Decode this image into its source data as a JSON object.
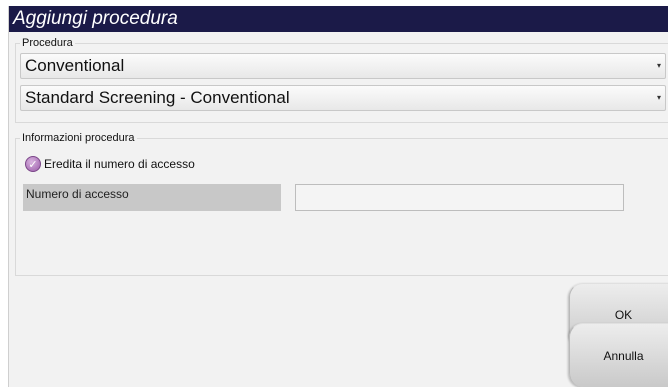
{
  "dialog": {
    "title": "Aggiungi procedura"
  },
  "procedure_section": {
    "legend": "Procedura",
    "procedure_select": {
      "value": "Conventional",
      "caret_icon": "chevron-down-icon"
    },
    "protocol_select": {
      "value": "Standard Screening - Conventional",
      "caret_icon": "chevron-down-icon"
    }
  },
  "info_section": {
    "legend": "Informazioni procedura",
    "inherit_checkbox": {
      "label": "Eredita il numero di accesso",
      "checked": true,
      "icon": "check-icon",
      "color": "#9a5aa8"
    },
    "accession": {
      "label": "Numero di accesso",
      "value": ""
    }
  },
  "buttons": {
    "ok": "OK",
    "cancel": "Annulla"
  }
}
